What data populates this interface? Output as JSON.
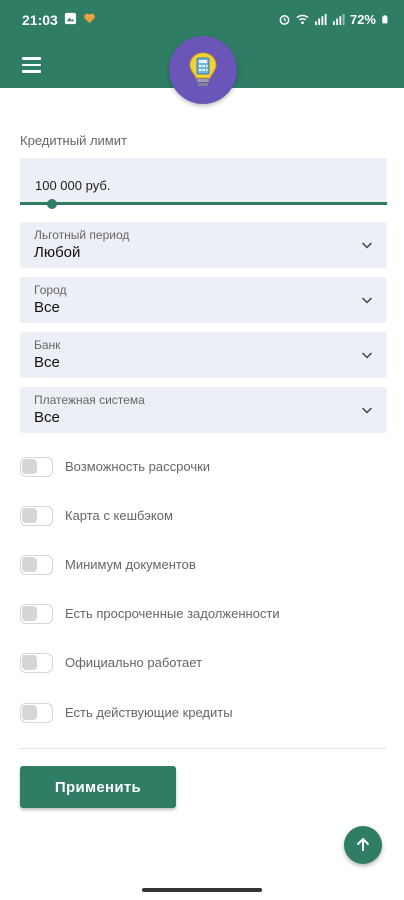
{
  "status_bar": {
    "time": "21:03",
    "battery": "72%"
  },
  "app": {
    "accent_color": "#2e7d64",
    "logo_icon": "lightbulb-calculator-icon"
  },
  "filters": {
    "credit_limit": {
      "label": "Кредитный лимит",
      "value": "100 000 руб.",
      "slider_fraction": 0.08
    },
    "selects": [
      {
        "label": "Льготный период",
        "value": "Любой"
      },
      {
        "label": "Город",
        "value": "Все"
      },
      {
        "label": "Банк",
        "value": "Все"
      },
      {
        "label": "Платежная система",
        "value": "Все"
      }
    ],
    "toggles": [
      {
        "label": "Возможность рассрочки",
        "on": false
      },
      {
        "label": "Карта с кешбэком",
        "on": false
      },
      {
        "label": "Минимум документов",
        "on": false
      },
      {
        "label": "Есть просроченные задолженности",
        "on": false
      },
      {
        "label": "Официально работает",
        "on": false
      },
      {
        "label": "Есть действующие кредиты",
        "on": false
      }
    ],
    "apply_label": "Применить"
  }
}
